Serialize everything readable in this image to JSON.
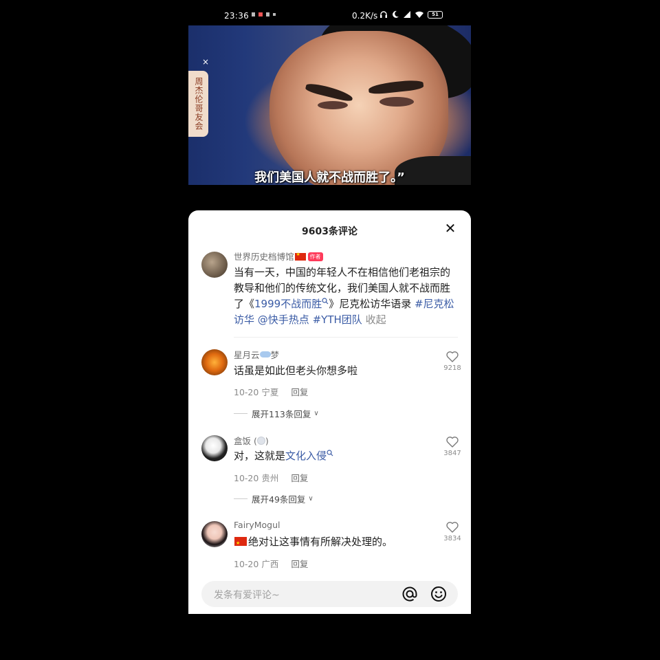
{
  "status_bar": {
    "time": "23:36",
    "network_speed": "0.2K/s",
    "battery": "51"
  },
  "video": {
    "subtitle": "我们美国人就不战而胜了。”",
    "side_tag": "周杰伦哥友会",
    "side_tag_close": "×"
  },
  "comments_panel": {
    "title": "9603条评论",
    "close": "✕",
    "author_post": {
      "username": "世界历史档博馆",
      "badge": "作者",
      "text_part1": "当有一天，中国的年轻人不在相信他们老祖宗的教导和他们的传统文化，我们美国人就不战而胜了《",
      "search_link": "1999不战而胜",
      "text_part2": "》尼克松访华语录 ",
      "hashtag1": "#尼克松访华",
      "mention": "@快手热点",
      "hashtag2": "#YTH团队",
      "collapse": "收起"
    },
    "comments": [
      {
        "username_prefix": "星月云",
        "username_suffix": "梦",
        "text": "话虽是如此但老头你想多啦",
        "date": "10-20",
        "location": "宁夏",
        "reply": "回复",
        "likes": "9218",
        "expand": "展开113条回复"
      },
      {
        "username_prefix": "盒饭 (",
        "username_suffix": ")",
        "text": "对，这就是",
        "text_link": "文化入侵",
        "date": "10-20",
        "location": "贵州",
        "reply": "回复",
        "likes": "3847",
        "expand": "展开49条回复"
      },
      {
        "username_prefix": "FairyMogul",
        "username_suffix": "",
        "text": "绝对让这事情有所解决处理的。",
        "date": "10-20",
        "location": "广西",
        "reply": "回复",
        "likes": "3834"
      }
    ],
    "input": {
      "placeholder": "发条有爱评论~"
    }
  }
}
